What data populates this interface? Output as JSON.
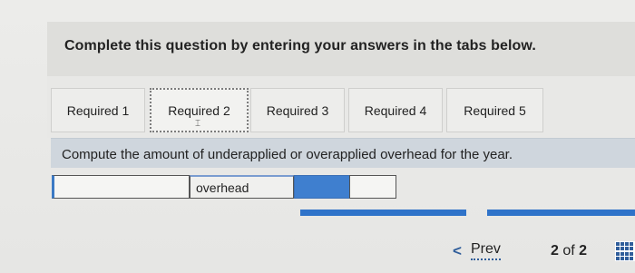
{
  "instruction": "Complete this question by entering your answers in the tabs below.",
  "tabs": [
    {
      "label": "Required 1",
      "active": false
    },
    {
      "label": "Required 2",
      "active": true
    },
    {
      "label": "Required 3",
      "active": false
    },
    {
      "label": "Required 4",
      "active": false
    },
    {
      "label": "Required 5",
      "active": false
    }
  ],
  "prompt": "Compute the amount of underapplied or overapplied overhead for the year.",
  "answer_row": {
    "input_value": "",
    "label": "overhead",
    "amount_value": ""
  },
  "navigation": {
    "prev_label": "Prev",
    "current_page": "2",
    "page_separator": "of",
    "total_pages": "2",
    "grid_icon": "grid-icon"
  },
  "colors": {
    "accent": "#2f73c9",
    "prompt_band": "#cfd6dd"
  }
}
